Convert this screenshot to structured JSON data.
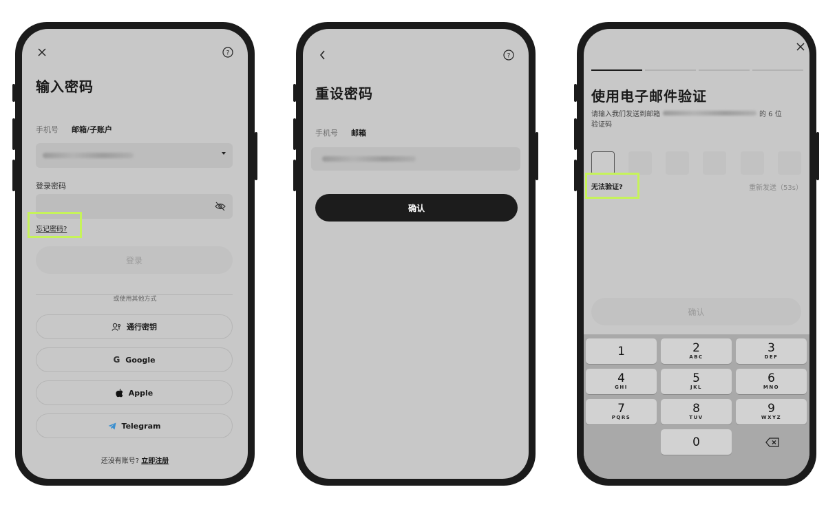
{
  "screen1": {
    "title": "输入密码",
    "tabs": [
      {
        "label": "手机号"
      },
      {
        "label": "邮箱/子账户"
      }
    ],
    "password_label": "登录密码",
    "forgot_link": "忘记密码?",
    "login_button": "登录",
    "divider_text": "或使用其他方式",
    "alt_buttons": [
      {
        "label": "通行密钥",
        "icon": "passkey-icon"
      },
      {
        "label": "Google",
        "icon": "google-icon"
      },
      {
        "label": "Apple",
        "icon": "apple-icon"
      },
      {
        "label": "Telegram",
        "icon": "telegram-icon"
      }
    ],
    "signup_prompt": "还没有账号?",
    "signup_link": "立即注册"
  },
  "screen2": {
    "title": "重设密码",
    "tabs": [
      {
        "label": "手机号"
      },
      {
        "label": "邮箱"
      }
    ],
    "confirm_button": "确认"
  },
  "screen3": {
    "title": "使用电子邮件验证",
    "instruction_prefix": "请输入我们发送到邮箱",
    "instruction_suffix": "的 6 位",
    "instruction_line2": "验证码",
    "cannot_verify_link": "无法验证?",
    "resend_text": "重新发送（53s）",
    "confirm_button": "确认",
    "keys": [
      {
        "num": "1",
        "sub": ""
      },
      {
        "num": "2",
        "sub": "ABC"
      },
      {
        "num": "3",
        "sub": "DEF"
      },
      {
        "num": "4",
        "sub": "GHI"
      },
      {
        "num": "5",
        "sub": "JKL"
      },
      {
        "num": "6",
        "sub": "MNO"
      },
      {
        "num": "7",
        "sub": "PQRS"
      },
      {
        "num": "8",
        "sub": "TUV"
      },
      {
        "num": "9",
        "sub": "WXYZ"
      },
      {
        "num": "0",
        "sub": ""
      }
    ]
  },
  "colors": {
    "screen_bg": "#c8c8c8",
    "highlight": "#c6f35a",
    "dark_button": "#1c1c1c",
    "telegram_blue": "#3a8fd0"
  }
}
